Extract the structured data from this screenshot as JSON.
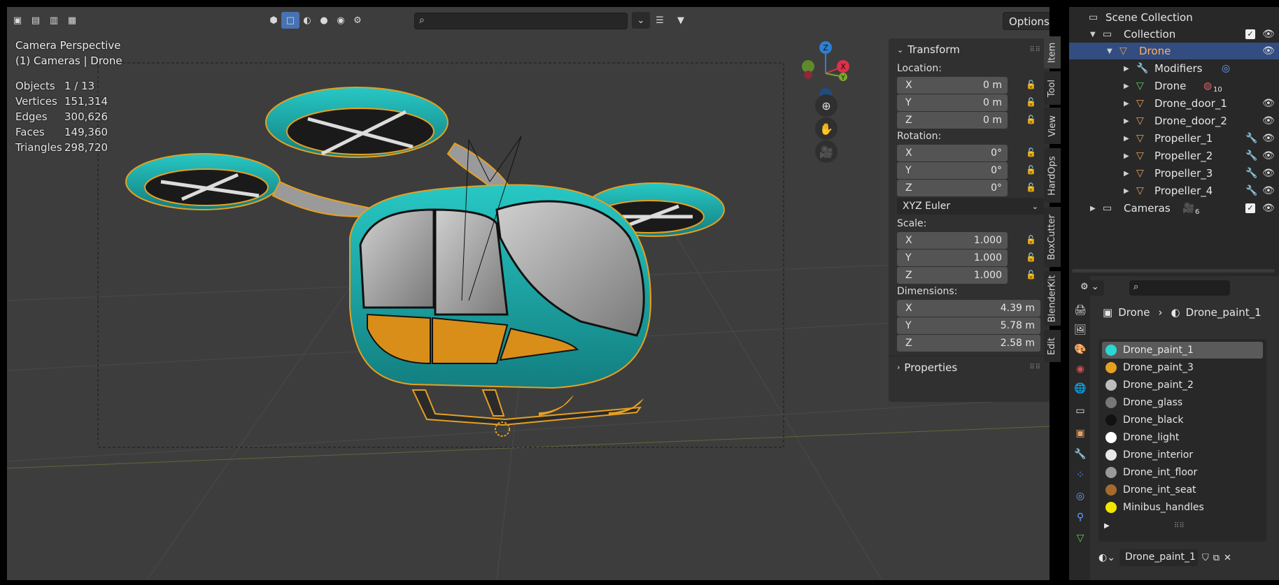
{
  "viewport": {
    "title": "Camera Perspective",
    "subtitle": "(1) Cameras | Drone",
    "options_label": "Options",
    "stats": [
      {
        "label": "Objects",
        "value": "1 / 13"
      },
      {
        "label": "Vertices",
        "value": "151,314"
      },
      {
        "label": "Edges",
        "value": "300,626"
      },
      {
        "label": "Faces",
        "value": "149,360"
      },
      {
        "label": "Triangles",
        "value": "298,720"
      }
    ],
    "gizmo": {
      "x": "X",
      "y": "Y",
      "z": "Z"
    }
  },
  "npanel": {
    "transform_label": "Transform",
    "location_label": "Location:",
    "location": [
      {
        "axis": "X",
        "value": "0 m"
      },
      {
        "axis": "Y",
        "value": "0 m"
      },
      {
        "axis": "Z",
        "value": "0 m"
      }
    ],
    "rotation_label": "Rotation:",
    "rotation": [
      {
        "axis": "X",
        "value": "0°"
      },
      {
        "axis": "Y",
        "value": "0°"
      },
      {
        "axis": "Z",
        "value": "0°"
      }
    ],
    "rotation_mode": "XYZ Euler",
    "scale_label": "Scale:",
    "scale": [
      {
        "axis": "X",
        "value": "1.000"
      },
      {
        "axis": "Y",
        "value": "1.000"
      },
      {
        "axis": "Z",
        "value": "1.000"
      }
    ],
    "dimensions_label": "Dimensions:",
    "dimensions": [
      {
        "axis": "X",
        "value": "4.39 m"
      },
      {
        "axis": "Y",
        "value": "5.78 m"
      },
      {
        "axis": "Z",
        "value": "2.58 m"
      }
    ],
    "properties_label": "Properties"
  },
  "vtabs": [
    "Item",
    "Tool",
    "View",
    "HardOps",
    "BoxCutter",
    "BlenderKit",
    "Edit"
  ],
  "outliner": {
    "scene_collection": "Scene Collection",
    "collection": "Collection",
    "drone": "Drone",
    "children": [
      {
        "label": "Modifiers"
      },
      {
        "label": "Drone",
        "badge": "10"
      },
      {
        "label": "Drone_door_1"
      },
      {
        "label": "Drone_door_2"
      },
      {
        "label": "Propeller_1"
      },
      {
        "label": "Propeller_2"
      },
      {
        "label": "Propeller_3"
      },
      {
        "label": "Propeller_4"
      }
    ],
    "cameras": "Cameras",
    "cameras_badge": "6"
  },
  "properties": {
    "breadcrumb_object": "Drone",
    "breadcrumb_material": "Drone_paint_1",
    "materials": [
      {
        "name": "Drone_paint_1",
        "color": "#2ad6d6"
      },
      {
        "name": "Drone_paint_3",
        "color": "#e6a020"
      },
      {
        "name": "Drone_paint_2",
        "color": "#bdbdbd"
      },
      {
        "name": "Drone_glass",
        "color": "#777777"
      },
      {
        "name": "Drone_black",
        "color": "#111111"
      },
      {
        "name": "Drone_light",
        "color": "#ffffff"
      },
      {
        "name": "Drone_interior",
        "color": "#e8e8e8"
      },
      {
        "name": "Drone_int_floor",
        "color": "#9a9a9a"
      },
      {
        "name": "Drone_int_seat",
        "color": "#a56b2c"
      },
      {
        "name": "Minibus_handles",
        "color": "#f2e600"
      }
    ],
    "active_material": "Drone_paint_1"
  }
}
